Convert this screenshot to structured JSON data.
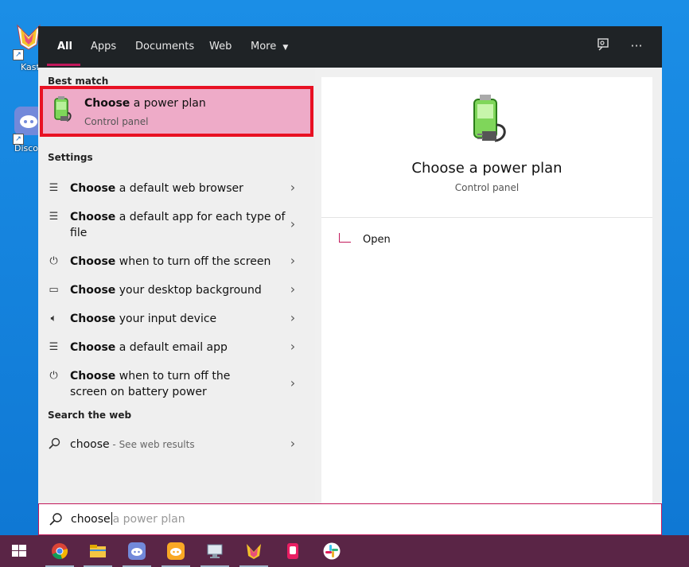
{
  "desktop": {
    "icons": [
      {
        "name": "kaspersky-desktop-icon",
        "label": "Kast"
      },
      {
        "name": "discord-desktop-icon",
        "label": "Disco"
      }
    ]
  },
  "tabs": [
    {
      "label": "All",
      "active": true
    },
    {
      "label": "Apps"
    },
    {
      "label": "Documents"
    },
    {
      "label": "Web"
    },
    {
      "label": "More"
    }
  ],
  "best_match": {
    "heading": "Best match",
    "title_bold": "Choose",
    "title_rest": " a power plan",
    "subtitle": "Control panel"
  },
  "settings": {
    "heading": "Settings",
    "items": [
      {
        "icon": "list-icon",
        "bold": "Choose",
        "rest": " a default web browser"
      },
      {
        "icon": "list-icon",
        "bold": "Choose",
        "rest": " a default app for each type of file"
      },
      {
        "icon": "power-icon",
        "bold": "Choose",
        "rest": " when to turn off the screen"
      },
      {
        "icon": "image-icon",
        "bold": "Choose",
        "rest": " your desktop background"
      },
      {
        "icon": "speaker-icon",
        "bold": "Choose",
        "rest": " your input device"
      },
      {
        "icon": "list-icon",
        "bold": "Choose",
        "rest": " a default email app"
      },
      {
        "icon": "power-icon",
        "bold": "Choose",
        "rest": " when to turn off the screen on battery power"
      }
    ]
  },
  "web": {
    "heading": "Search the web",
    "query": "choose",
    "suffix": " - See web results"
  },
  "preview": {
    "title": "Choose a power plan",
    "subtitle": "Control panel",
    "action_open": "Open"
  },
  "searchbox": {
    "typed": "choose",
    "ghost": "a power plan"
  },
  "taskbar": {
    "items": [
      "windows-start-icon",
      "chrome-icon",
      "file-explorer-icon",
      "discord-icon",
      "discord-canary-icon",
      "remote-desktop-icon",
      "kaspersky-icon",
      "app-icon",
      "slack-icon"
    ]
  },
  "colors": {
    "accent": "#c2185b",
    "highlight": "#e81123",
    "taskbar": "#5a2546"
  }
}
